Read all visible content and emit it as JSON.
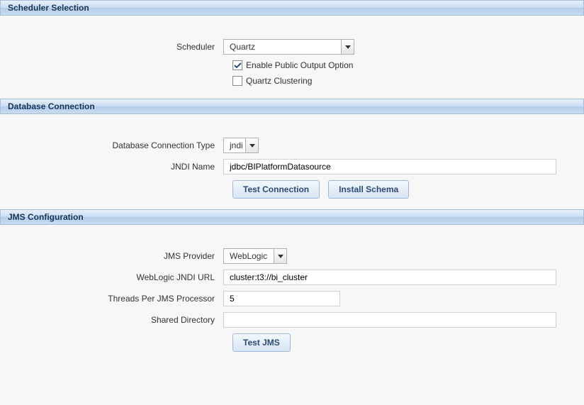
{
  "scheduler_selection": {
    "header": "Scheduler Selection",
    "scheduler_label": "Scheduler",
    "scheduler_value": "Quartz",
    "enable_public_output": {
      "label": "Enable Public Output Option",
      "checked": true
    },
    "quartz_clustering": {
      "label": "Quartz Clustering",
      "checked": false
    }
  },
  "database_connection": {
    "header": "Database Connection",
    "connection_type_label": "Database Connection Type",
    "connection_type_value": "jndi",
    "jndi_name_label": "JNDI Name",
    "jndi_name_value": "jdbc/BIPlatformDatasource",
    "test_connection_label": "Test Connection",
    "install_schema_label": "Install Schema"
  },
  "jms_configuration": {
    "header": "JMS Configuration",
    "provider_label": "JMS Provider",
    "provider_value": "WebLogic",
    "jndi_url_label": "WebLogic JNDI URL",
    "jndi_url_value": "cluster:t3://bi_cluster",
    "threads_label": "Threads Per JMS Processor",
    "threads_value": "5",
    "shared_dir_label": "Shared Directory",
    "shared_dir_value": "",
    "test_jms_label": "Test JMS"
  }
}
